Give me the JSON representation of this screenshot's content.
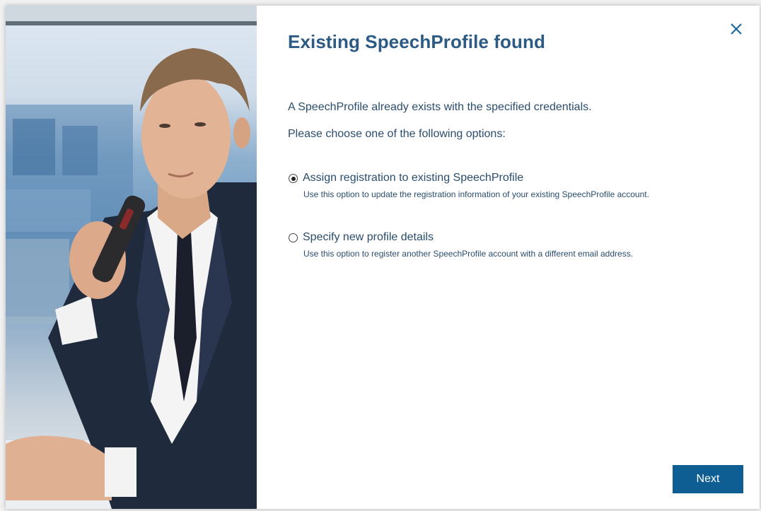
{
  "dialog": {
    "title": "Existing SpeechProfile found",
    "message_line1": "A SpeechProfile already exists with the specified credentials.",
    "message_line2": "Please choose one of the following options:",
    "options": [
      {
        "label": "Assign registration to existing SpeechProfile",
        "description": "Use this option to update the registration information of your existing SpeechProfile account.",
        "selected": true
      },
      {
        "label": "Specify new profile details",
        "description": "Use this option to register another SpeechProfile account with a different email address.",
        "selected": false
      }
    ],
    "next_label": "Next",
    "close_icon": "close-icon"
  },
  "colors": {
    "title": "#2b5b84",
    "text": "#2a4d6e",
    "primary_button": "#0f5e93",
    "close_icon": "#1e6aa0"
  }
}
